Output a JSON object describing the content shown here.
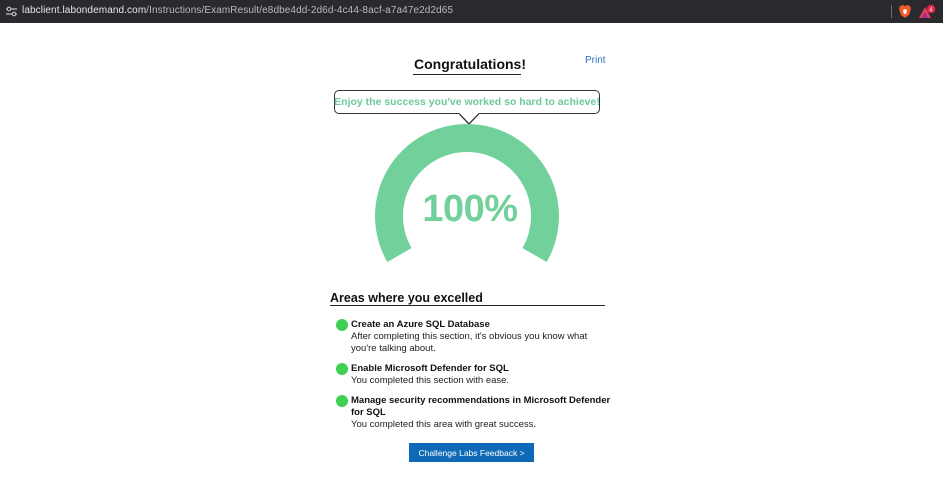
{
  "browser": {
    "url_host": "labclient.labondemand.com",
    "url_path": "/Instructions/ExamResult/e8dbe4dd-2d6d-4c44-8acf-a7a47e2d2d65",
    "notification_count": "4",
    "icons": [
      "site-settings-icon",
      "brave-shields-icon",
      "brave-rewards-icon"
    ]
  },
  "header": {
    "title": "Congratulations!",
    "print_label": "Print"
  },
  "bubble": {
    "message": "Enjoy the success you've worked so hard to achieve!"
  },
  "score": {
    "value": "100%",
    "fraction": 1.0
  },
  "areas": {
    "title": "Areas where you excelled",
    "items": [
      {
        "name": "Create an Azure SQL Database",
        "desc": "After completing this section, it's obvious you know what you're talking about."
      },
      {
        "name": "Enable Microsoft Defender for SQL",
        "desc": "You completed this section with ease."
      },
      {
        "name": "Manage security recommendations in Microsoft Defender for SQL",
        "desc": "You completed this area with great success."
      }
    ]
  },
  "feedback_button": {
    "label": "Challenge Labs Feedback >"
  },
  "colors": {
    "gauge": "#72d09b",
    "bubble_text": "#6cc99a",
    "status_dot": "#3fcf52",
    "button": "#0e6ab6",
    "link": "#2a73c4",
    "topbar": "#2a2a2e"
  }
}
